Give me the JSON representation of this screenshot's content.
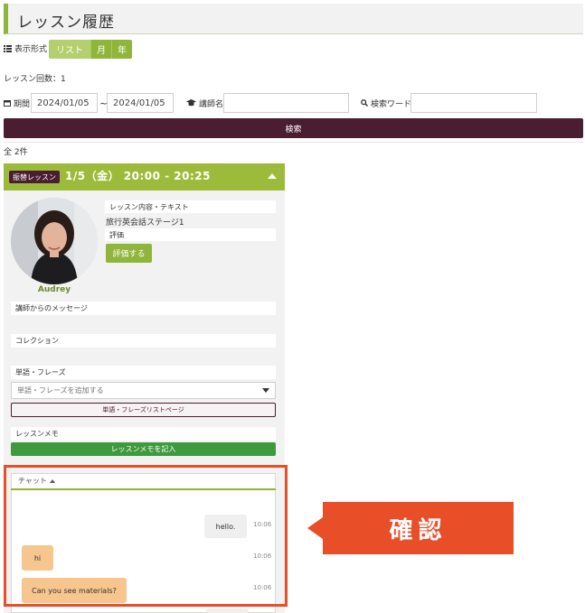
{
  "page": {
    "title": "レッスン履歴"
  },
  "display_format": {
    "label": "表示形式",
    "options": [
      "リスト",
      "月",
      "年"
    ],
    "selected": "リスト"
  },
  "lesson_count": "レッスン回数：1",
  "filters": {
    "period_label": "期間",
    "date_from": "2024/01/05",
    "separator": "~",
    "date_to": "2024/01/05",
    "teacher_label": "講師名",
    "teacher_value": "",
    "keyword_label": "検索ワード",
    "keyword_value": ""
  },
  "search_button": "検索",
  "total": "全 2件",
  "lesson": {
    "badge": "振替レッスン",
    "datetime": "1/5（金） 20:00 - 20:25",
    "teacher_name": "Audrey",
    "content_label": "レッスン内容・テキスト",
    "content_value": "旅行英会話ステージ1",
    "rating_label": "評価",
    "rate_button": "評価する",
    "message_label": "講師からのメッセージ",
    "collection_label": "コレクション",
    "phrases_label": "単語・フレーズ",
    "phrases_placeholder": "単語・フレーズを追加する",
    "phrase_list_button": "単語・フレーズリストページ",
    "memo_label": "レッスンメモ",
    "memo_button": "レッスンメモを記入"
  },
  "chat": {
    "label": "チャット",
    "messages": [
      {
        "sender": "me",
        "text": "hello.",
        "time": "10:06"
      },
      {
        "sender": "them",
        "text": "hi",
        "time": "10:06"
      },
      {
        "sender": "them",
        "text": "Can you see materials?",
        "time": "10:06"
      }
    ]
  },
  "callout": {
    "text": "確認"
  },
  "colors": {
    "accent_green": "#8fb53a",
    "dark_purple": "#4a1d31",
    "highlight_orange": "#e84e28",
    "chat_bubble_them": "#f7c68e"
  }
}
